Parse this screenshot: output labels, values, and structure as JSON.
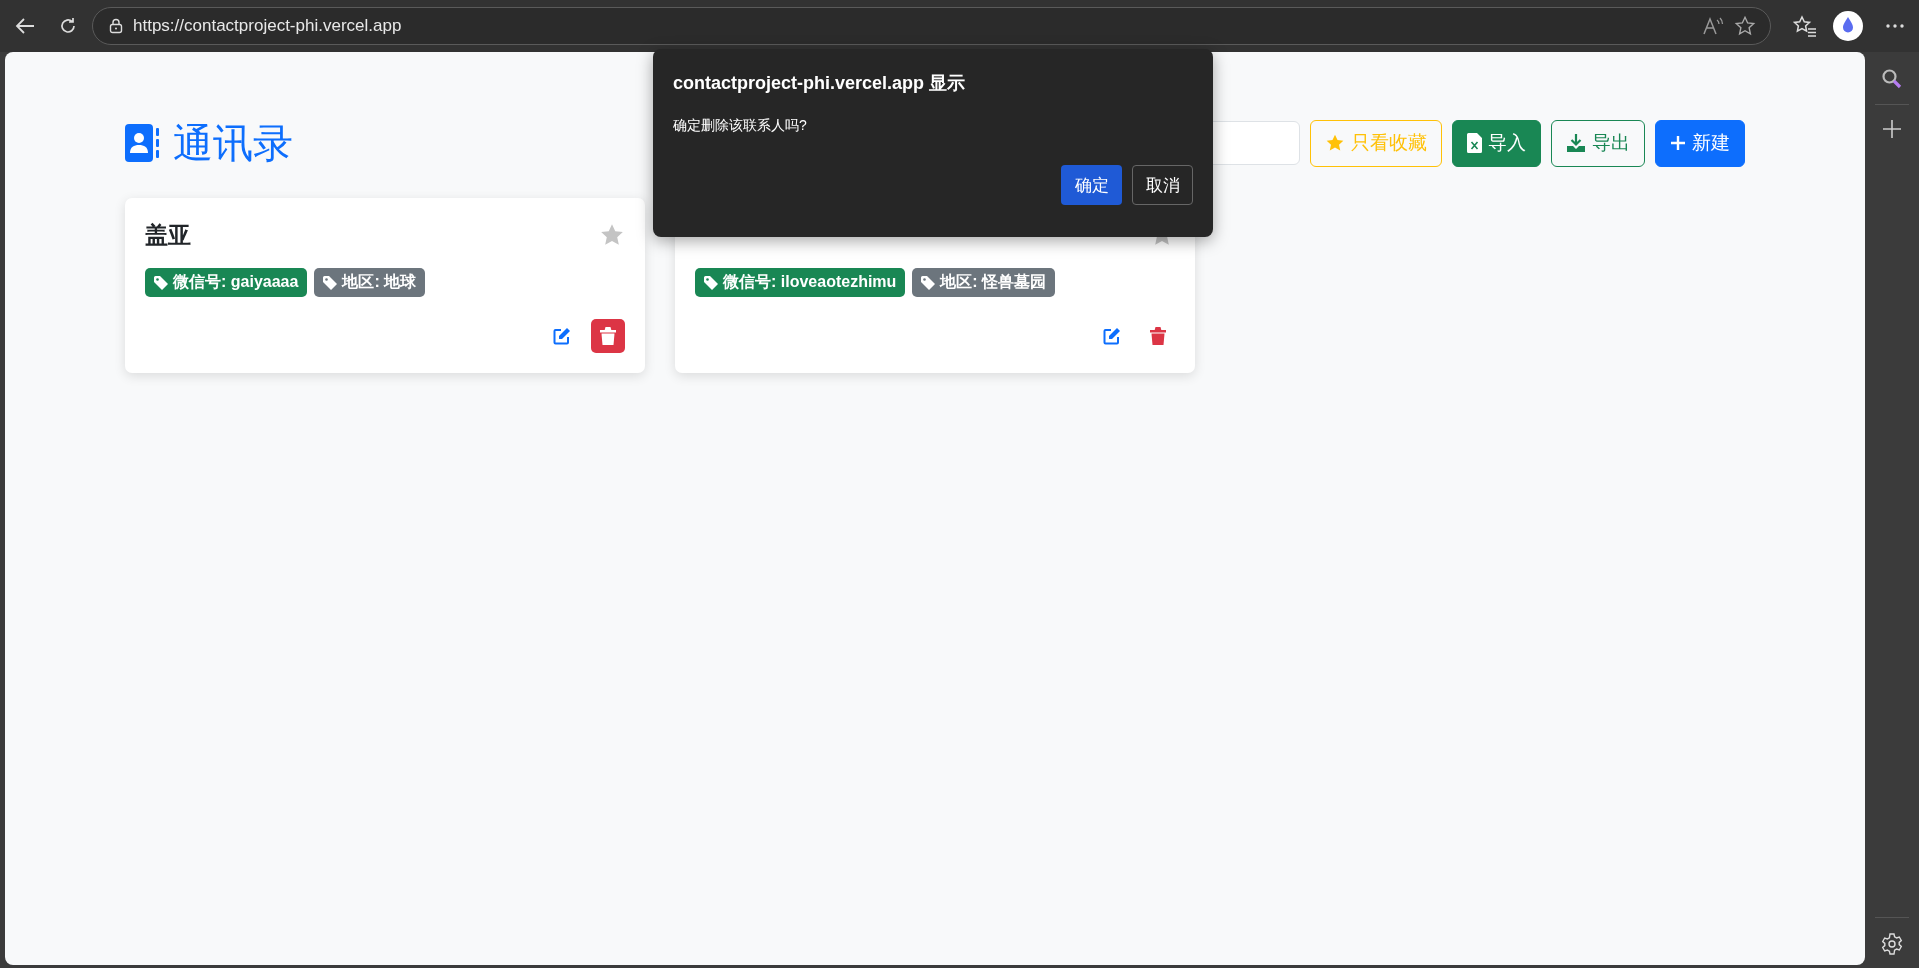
{
  "browser": {
    "url": "https://contactproject-phi.vercel.app"
  },
  "app": {
    "title": "通讯录"
  },
  "toolbar": {
    "favorites_filter": {
      "label": "只看收藏",
      "selected": false
    },
    "import_button": "导入",
    "export_button": "导出",
    "new_button": "新建"
  },
  "contacts": [
    {
      "name": "盖亚",
      "favorite": false,
      "delete_highlighted": true,
      "tags": [
        {
          "text": "微信号: gaiyaaaa",
          "color": "#198754"
        },
        {
          "text": "地区: 地球",
          "color": "#6c757d"
        }
      ]
    },
    {
      "favorite": false,
      "delete_highlighted": false,
      "tags": [
        {
          "text": "微信号: iloveaotezhimu",
          "color": "#198754"
        },
        {
          "text": "地区: 怪兽墓园",
          "color": "#6c757d"
        }
      ]
    }
  ],
  "dialog": {
    "title": "contactproject-phi.vercel.app 显示",
    "message": "确定删除该联系人吗?",
    "ok": "确定",
    "cancel": "取消"
  }
}
